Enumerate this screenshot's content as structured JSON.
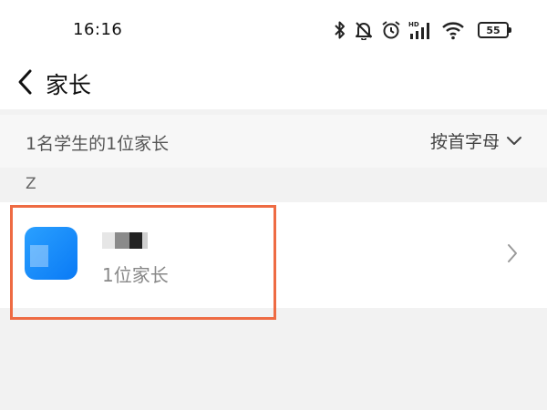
{
  "status_bar": {
    "time": "16:16",
    "battery_level": "55",
    "icons": [
      "bluetooth-icon",
      "bell-muted-icon",
      "alarm-icon",
      "hd-signal-icon",
      "wifi-icon",
      "battery-icon"
    ]
  },
  "header": {
    "title": "家长",
    "back_icon": "chevron-left-icon"
  },
  "summary": {
    "text": "1名学生的1位家长",
    "sort_label": "按首字母",
    "sort_icon": "chevron-down-icon"
  },
  "list": {
    "section_letter": "Z",
    "items": [
      {
        "subtitle": "1位家长",
        "avatar_color": "#1a8cff"
      }
    ]
  },
  "colors": {
    "highlight_border": "#ee6b43",
    "page_background": "#f2f2f2"
  }
}
